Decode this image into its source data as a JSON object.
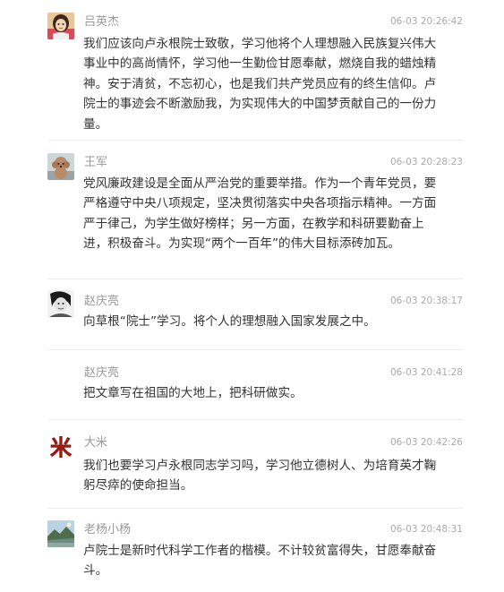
{
  "comments": [
    {
      "user": "吕英杰",
      "time": "06-03 20:26:42",
      "avatar_icon": "child-photo-avatar",
      "text": "我们应该向卢永根院士致敬，学习他将个人理想融入民族复兴伟大事业中的高尚情怀，学习他一生勤俭甘愿奉献，燃烧自我的蜡烛精神。安于清贫，不忘初心，也是我们共产党员应有的终生信仰。卢院士的事迹会不断激励我，为实现伟大的中国梦贡献自己的一份力量。"
    },
    {
      "user": "王军",
      "time": "06-03 20:28:23",
      "avatar_icon": "poodle-dog-avatar",
      "text": "党风廉政建设是全面从严治党的重要举措。作为一个青年党员，要严格遵守中央八项规定，坚决贯彻落实中央各项指示精神。一方面严于律己，为学生做好榜样；另一方面，在教学和科研要勤奋上进，积极奋斗。为实现“两个一百年”的伟大目标添砖加瓦。"
    },
    {
      "user": "赵庆亮",
      "time": "06-03 20:38:17",
      "avatar_icon": "bw-portrait-avatar",
      "text": "向草根“院士”学习。将个人的理想融入国家发展之中。"
    },
    {
      "user": "赵庆亮",
      "time": "06-03 20:41:28",
      "avatar_icon": "",
      "text": "把文章写在祖国的大地上，把科研做实。"
    },
    {
      "user": "大米",
      "time": "06-03 20:42:26",
      "avatar_icon": "rice-character-avatar",
      "avatar_glyph": "米",
      "text": "我们也要学习卢永根同志学习吗，学习他立德树人、为培育英才鞠躬尽瘁的使命担当。"
    },
    {
      "user": "老杨小杨",
      "time": "06-03 20:48:31",
      "avatar_icon": "landscape-photo-avatar",
      "text": "卢院士是新时代科学工作者的楷模。不计较贫富得失，甘愿奉献奋斗。"
    }
  ]
}
